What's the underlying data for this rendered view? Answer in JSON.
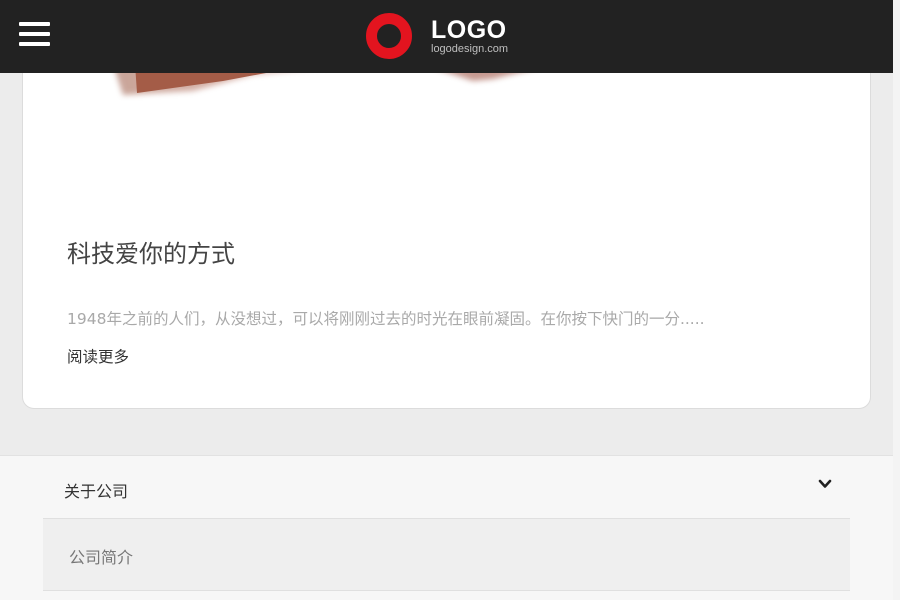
{
  "header": {
    "menu_icon": "hamburger-menu-icon",
    "logo": {
      "mark_icon": "red-ring-logo-icon",
      "title": "LOGO",
      "subtitle": "logodesign.com",
      "mark_color": "#e3141f"
    },
    "background_color": "#222222"
  },
  "article": {
    "title": "科技爱你的方式",
    "summary": "1948年之前的人们，从没想过，可以将刚刚过去的时光在眼前凝固。在你按下快门的一分.....",
    "read_more": "阅读更多"
  },
  "footer": {
    "section_title": "关于公司",
    "expand_icon": "chevron-down-icon",
    "items": [
      {
        "label": "公司简介"
      }
    ]
  }
}
